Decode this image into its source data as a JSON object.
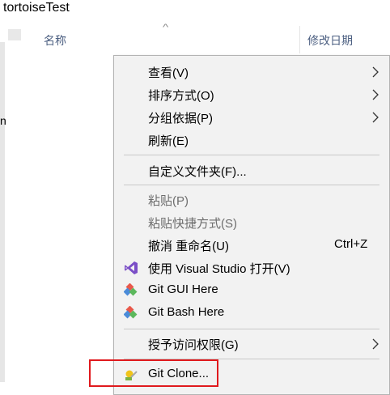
{
  "window": {
    "title": "tortoiseTest"
  },
  "nav_pane": {
    "cutoff_text": "n"
  },
  "columns": {
    "sort_indicator": "^",
    "name": "名称",
    "modified": "修改日期"
  },
  "context_menu": {
    "view": "查看(V)",
    "sort_by": "排序方式(O)",
    "group_by": "分组依据(P)",
    "refresh": "刷新(E)",
    "customize_folder": "自定义文件夹(F)...",
    "paste": "粘贴(P)",
    "paste_shortcut": "粘贴快捷方式(S)",
    "undo_rename": "撤消 重命名(U)",
    "undo_shortcut": "Ctrl+Z",
    "open_with_vs": "使用 Visual Studio 打开(V)",
    "git_gui": "Git GUI Here",
    "git_bash": "Git Bash Here",
    "give_access": "授予访问权限(G)",
    "git_clone": "Git Clone..."
  },
  "colors": {
    "menu_background": "#f2f2f2",
    "disabled_text": "#6d6d6d",
    "header_text": "#4d6082",
    "highlight_border": "#e0191d"
  }
}
